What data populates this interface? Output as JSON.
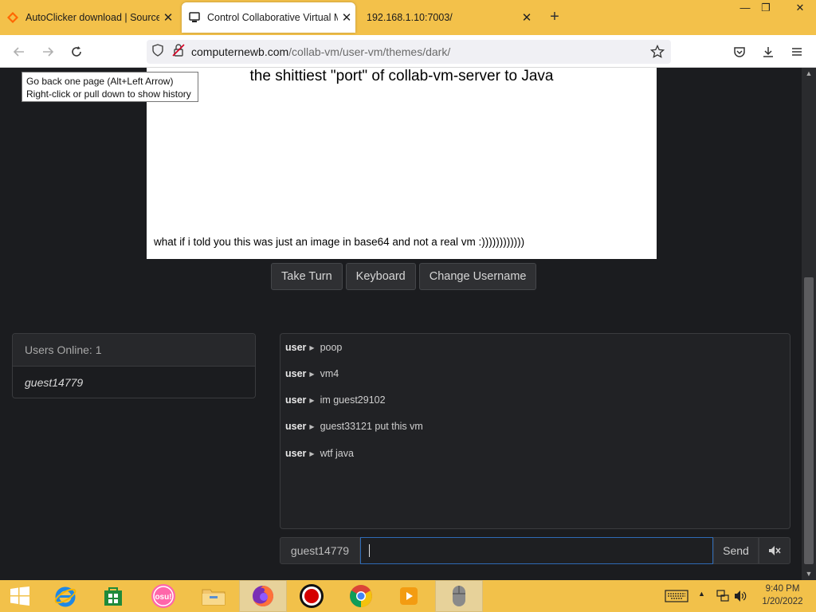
{
  "browser": {
    "tabs": [
      {
        "title": "AutoClicker download | SourceF",
        "active": false
      },
      {
        "title": "Control Collaborative Virtual M",
        "active": true
      },
      {
        "title": "192.168.1.10:7003/",
        "active": false
      }
    ],
    "url_domain": "computernewb.com",
    "url_path": "/collab-vm/user-vm/themes/dark/",
    "tooltip": {
      "line1": "Go back one page (Alt+Left Arrow)",
      "line2": "Right-click or pull down to show history"
    }
  },
  "vm": {
    "heading": "the shittiest \"port\" of collab-vm-server to Java",
    "caption": "what if i told you this was just an image in base64 and not a real vm :))))))))))))"
  },
  "controls": {
    "take_turn": "Take Turn",
    "keyboard": "Keyboard",
    "change_username": "Change Username"
  },
  "users": {
    "header": "Users Online: 1",
    "list": [
      "guest14779"
    ]
  },
  "chat": {
    "messages": [
      {
        "user": "user",
        "text": "poop"
      },
      {
        "user": "user",
        "text": "vm4"
      },
      {
        "user": "user",
        "text": "im guest29102"
      },
      {
        "user": "user",
        "text": "guest33121 put this vm"
      },
      {
        "user": "user",
        "text": "wtf java"
      }
    ],
    "username": "guest14779",
    "input_value": "",
    "send_label": "Send"
  },
  "taskbar": {
    "time": "9:40 PM",
    "date": "1/20/2022",
    "osu_label": "osu!"
  },
  "colors": {
    "tabstrip": "#f3c14a",
    "page_bg": "#1b1c1f",
    "panel_bg": "#212225",
    "focus_border": "#2e6ab5"
  }
}
